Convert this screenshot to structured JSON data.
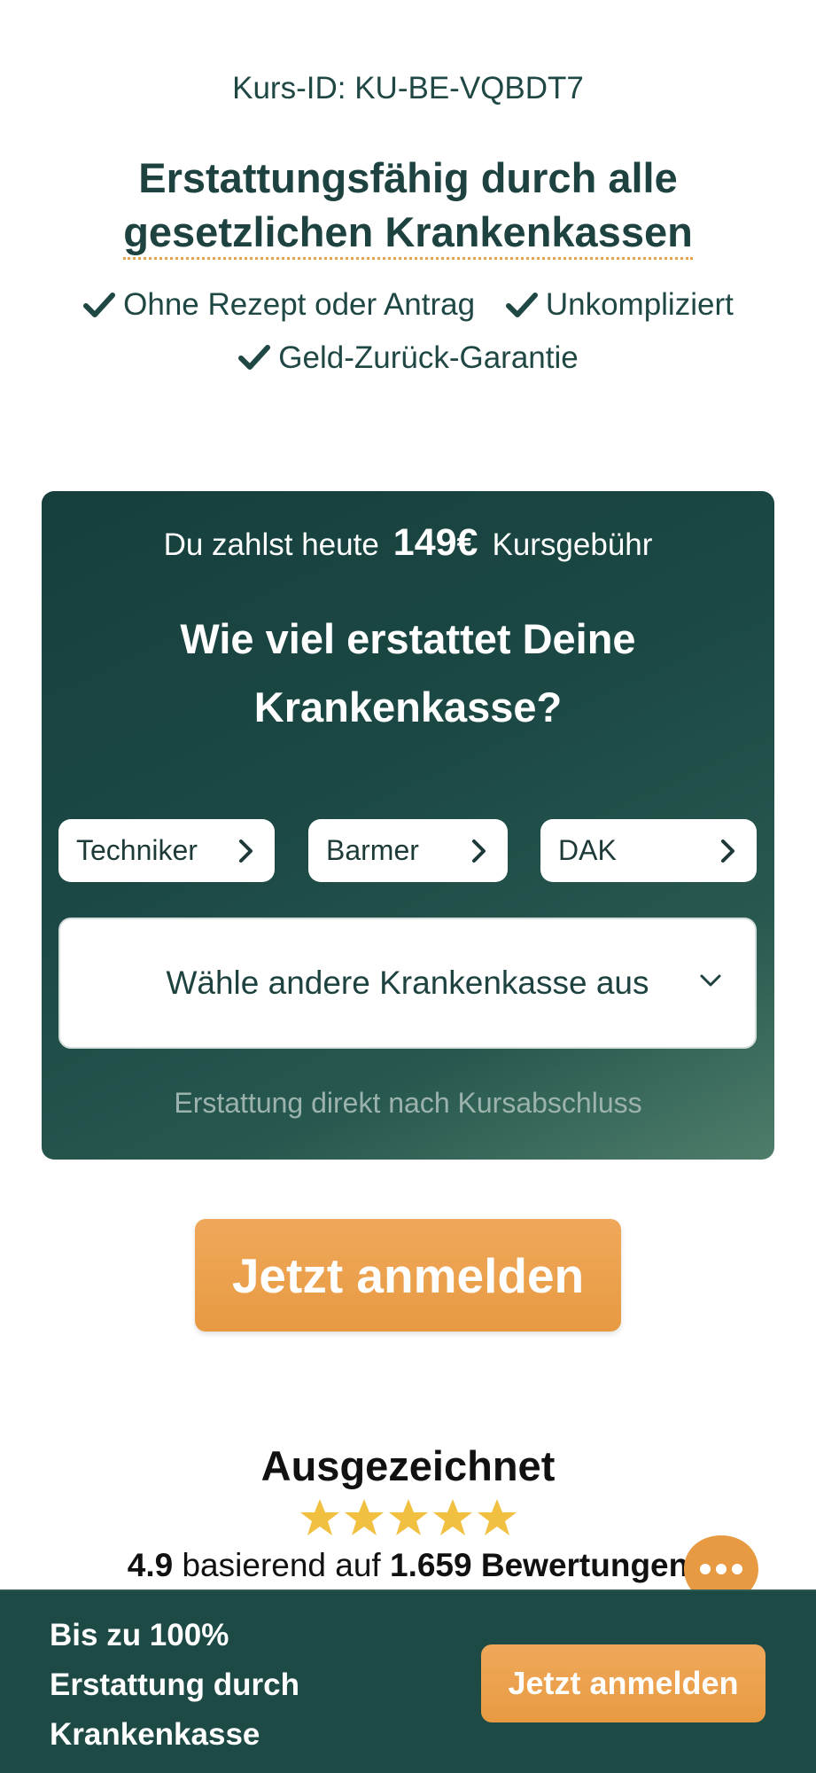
{
  "course": {
    "id_label": "Kurs-ID: KU-BE-VQBDT7"
  },
  "headline": {
    "line1": "Erstattungsfähig durch alle",
    "line2": "gesetzlichen Krankenkassen"
  },
  "checks": [
    "Ohne Rezept oder Antrag",
    "Unkompliziert",
    "Geld-Zurück-Garantie"
  ],
  "calculator": {
    "pay_prefix": "Du zahlst heute",
    "price": "149€",
    "pay_suffix": "Kursgebühr",
    "question_line1": "Wie viel erstattet Deine",
    "question_line2": "Krankenkasse?",
    "insurers": [
      "Techniker",
      "Barmer",
      "DAK"
    ],
    "select_label": "Wähle andere Krankenkasse aus",
    "note": "Erstattung direkt nach Kursabschluss"
  },
  "cta": {
    "main_label": "Jetzt anmelden"
  },
  "rating": {
    "title": "Ausgezeichnet",
    "stars": 5,
    "score": "4.9",
    "based_on": "basierend auf",
    "count": "1.659 Bewertungen"
  },
  "bottom_bar": {
    "line1": "Bis zu 100%",
    "line2": "Erstattung durch",
    "line3": "Krankenkasse",
    "button_label": "Jetzt anmelden"
  },
  "colors": {
    "primary": "#1d4a45",
    "accent": "#e89a42",
    "star": "#f2c040"
  },
  "icons": {
    "check": "check-icon",
    "chevron_right": "chevron-right-icon",
    "chevron_down": "chevron-down-icon",
    "chat": "chat-bubble-icon",
    "star": "star-icon"
  }
}
